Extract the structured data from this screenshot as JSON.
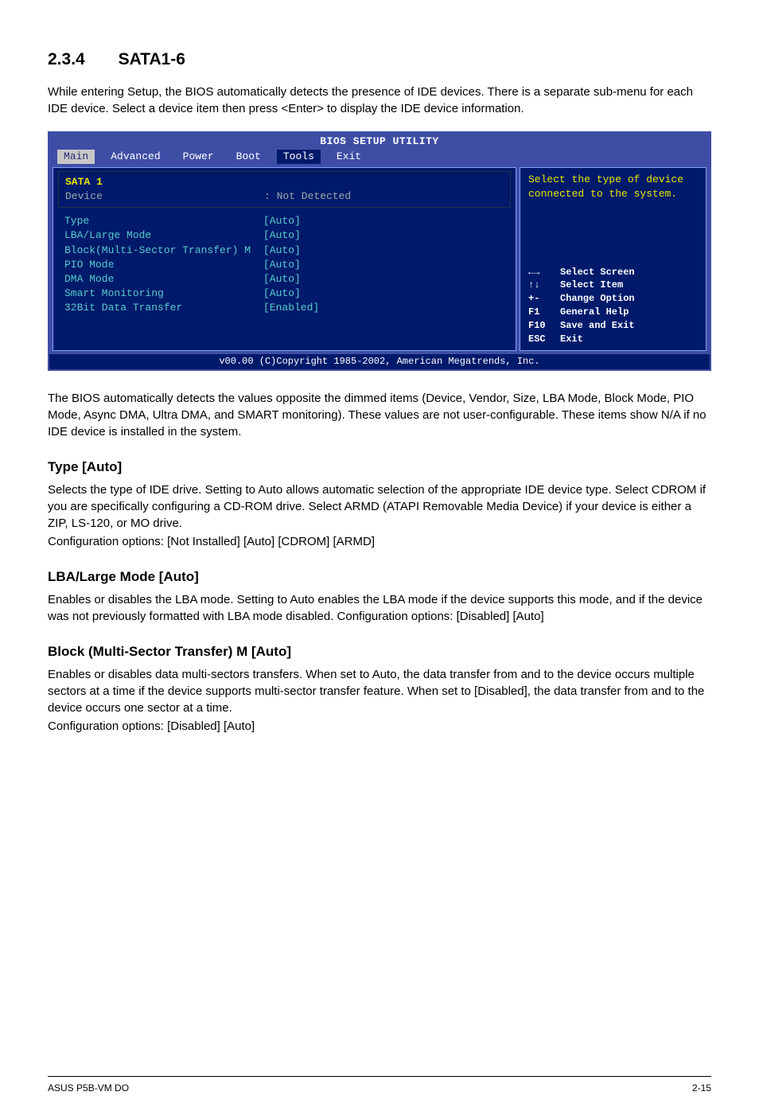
{
  "section": {
    "number": "2.3.4",
    "title": "SATA1-6"
  },
  "intro": "While entering Setup, the BIOS automatically detects the presence of IDE devices. There is a separate sub-menu for each IDE device. Select a device item then press <Enter> to display the IDE device information.",
  "bios": {
    "title": "BIOS SETUP UTILITY",
    "tabs": [
      "Main",
      "Advanced",
      "Power",
      "Boot",
      "Tools",
      "Exit"
    ],
    "left_box": {
      "header": "SATA 1",
      "device_label": "Device",
      "device_value": ": Not Detected"
    },
    "items": [
      {
        "label": "Type",
        "value": "[Auto]"
      },
      {
        "label": "LBA/Large Mode",
        "value": "[Auto]"
      },
      {
        "label": "Block(Multi-Sector Transfer) M",
        "value": "[Auto]"
      },
      {
        "label": "PIO Mode",
        "value": "[Auto]"
      },
      {
        "label": "DMA Mode",
        "value": "[Auto]"
      },
      {
        "label": "Smart Monitoring",
        "value": "[Auto]"
      },
      {
        "label": "32Bit Data Transfer",
        "value": "[Enabled]"
      }
    ],
    "help_top": "Select the type of device connected to the system.",
    "help_keys": [
      {
        "k": "←→",
        "d": "Select Screen"
      },
      {
        "k": "↑↓",
        "d": "Select Item"
      },
      {
        "k": "+-",
        "d": "Change Option"
      },
      {
        "k": "F1",
        "d": "General Help"
      },
      {
        "k": "F10",
        "d": "Save and Exit"
      },
      {
        "k": "ESC",
        "d": "Exit"
      }
    ],
    "footer": "v00.00 (C)Copyright 1985-2002, American Megatrends, Inc."
  },
  "post_bios": "The BIOS automatically detects the values opposite the dimmed items (Device, Vendor, Size, LBA Mode, Block Mode, PIO Mode, Async DMA, Ultra DMA, and SMART monitoring). These values are not user-configurable. These items show N/A if no IDE device is installed in the system.",
  "type_section": {
    "heading": "Type [Auto]",
    "body": "Selects the type of IDE drive. Setting to Auto allows automatic selection of the appropriate IDE device type. Select CDROM if you are specifically configuring a CD-ROM drive. Select ARMD (ATAPI Removable Media Device) if your device is either a ZIP, LS-120, or MO drive.",
    "config": "Configuration options: [Not Installed] [Auto] [CDROM] [ARMD]"
  },
  "lba_section": {
    "heading": "LBA/Large Mode [Auto]",
    "body": "Enables or disables the LBA mode. Setting to Auto enables the LBA mode if the device supports this mode, and if the device was not previously formatted with LBA mode disabled. Configuration options: [Disabled] [Auto]"
  },
  "block_section": {
    "heading": "Block (Multi-Sector Transfer) M [Auto]",
    "body": "Enables or disables data multi-sectors transfers. When set to Auto, the data transfer from and to the device occurs multiple sectors at a time if the device supports multi-sector transfer feature. When set to [Disabled], the data transfer from and to the device occurs one sector at a time.",
    "config": "Configuration options: [Disabled] [Auto]"
  },
  "footer": {
    "left": "ASUS P5B-VM DO",
    "right": "2-15"
  }
}
